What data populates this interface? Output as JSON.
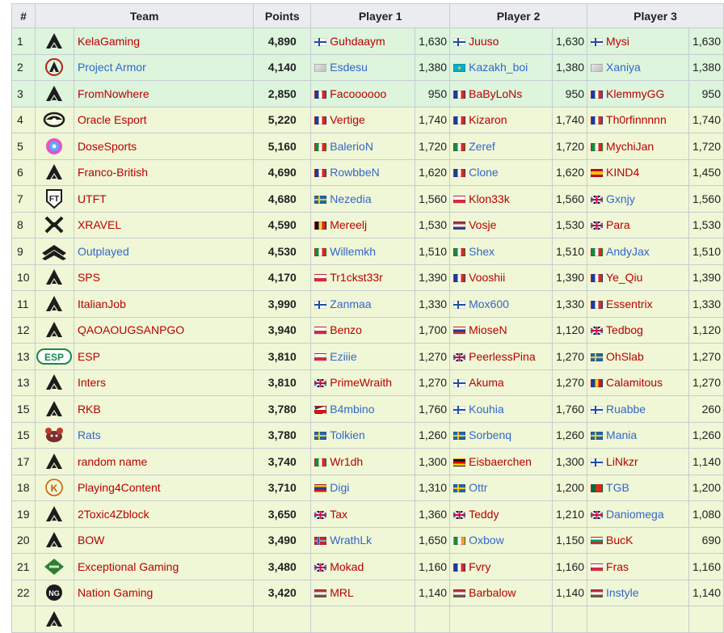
{
  "headers": {
    "rank": "#",
    "team": "Team",
    "points": "Points",
    "p1": "Player 1",
    "p2": "Player 2",
    "p3": "Player 3"
  },
  "rows": [
    {
      "rank": "1",
      "team": "KelaGaming",
      "team_link": "red",
      "logo": "apex-icon",
      "points": "4,890",
      "top": true,
      "p1": {
        "flag": "fi",
        "name": "Guhdaaym",
        "link": "red",
        "val": "1,630"
      },
      "p2": {
        "flag": "fi",
        "name": "Juuso",
        "link": "red",
        "val": "1,630"
      },
      "p3": {
        "flag": "fi",
        "name": "Mysi",
        "link": "red",
        "val": "1,630"
      }
    },
    {
      "rank": "2",
      "team": "Project Armor",
      "team_link": "blue",
      "logo": "project-armor-icon",
      "points": "4,140",
      "top": true,
      "p1": {
        "flag": "unk",
        "name": "Esdesu",
        "link": "blue",
        "val": "1,380"
      },
      "p2": {
        "flag": "kz",
        "name": "Kazakh_boi",
        "link": "blue",
        "val": "1,380"
      },
      "p3": {
        "flag": "unk",
        "name": "Xaniya",
        "link": "blue",
        "val": "1,380"
      }
    },
    {
      "rank": "3",
      "team": "FromNowhere",
      "team_link": "red",
      "logo": "apex-icon",
      "points": "2,850",
      "top": true,
      "p1": {
        "flag": "fr",
        "name": "Facoooooo",
        "link": "red",
        "val": "950"
      },
      "p2": {
        "flag": "fr",
        "name": "BaByLoNs",
        "link": "red",
        "val": "950"
      },
      "p3": {
        "flag": "fr",
        "name": "KlemmyGG",
        "link": "red",
        "val": "950"
      }
    },
    {
      "rank": "4",
      "team": "Oracle Esport",
      "team_link": "red",
      "logo": "oracle-icon",
      "points": "5,220",
      "top": false,
      "p1": {
        "flag": "fr",
        "name": "Vertige",
        "link": "red",
        "val": "1,740"
      },
      "p2": {
        "flag": "fr",
        "name": "Kizaron",
        "link": "red",
        "val": "1,740"
      },
      "p3": {
        "flag": "fr",
        "name": "Th0rfinnnnn",
        "link": "red",
        "val": "1,740"
      }
    },
    {
      "rank": "5",
      "team": "DoseSports",
      "team_link": "red",
      "logo": "dose-icon",
      "points": "5,160",
      "top": false,
      "p1": {
        "flag": "it",
        "name": "BalerioN",
        "link": "blue",
        "val": "1,720"
      },
      "p2": {
        "flag": "it",
        "name": "Zeref",
        "link": "blue",
        "val": "1,720"
      },
      "p3": {
        "flag": "it",
        "name": "MychiJan",
        "link": "red",
        "val": "1,720"
      }
    },
    {
      "rank": "6",
      "team": "Franco-British",
      "team_link": "red",
      "logo": "apex-icon",
      "points": "4,690",
      "top": false,
      "p1": {
        "flag": "fr",
        "name": "RowbbeN",
        "link": "blue",
        "val": "1,620"
      },
      "p2": {
        "flag": "fr",
        "name": "Clone",
        "link": "blue",
        "val": "1,620"
      },
      "p3": {
        "flag": "es",
        "name": "KIND4",
        "link": "red",
        "val": "1,450"
      }
    },
    {
      "rank": "7",
      "team": "UTFT",
      "team_link": "red",
      "logo": "utft-icon",
      "points": "4,680",
      "top": false,
      "p1": {
        "flag": "se",
        "name": "Nezedia",
        "link": "blue",
        "val": "1,560"
      },
      "p2": {
        "flag": "pl",
        "name": "Klon33k",
        "link": "red",
        "val": "1,560"
      },
      "p3": {
        "flag": "gb",
        "name": "Gxnjy",
        "link": "blue",
        "val": "1,560"
      }
    },
    {
      "rank": "8",
      "team": "XRAVEL",
      "team_link": "red",
      "logo": "xravel-icon",
      "points": "4,590",
      "top": false,
      "p1": {
        "flag": "be",
        "name": "Mereelj",
        "link": "red",
        "val": "1,530"
      },
      "p2": {
        "flag": "nl",
        "name": "Vosje",
        "link": "red",
        "val": "1,530"
      },
      "p3": {
        "flag": "gb",
        "name": "Para",
        "link": "red",
        "val": "1,530"
      }
    },
    {
      "rank": "9",
      "team": "Outplayed",
      "team_link": "blue",
      "logo": "outplayed-icon",
      "points": "4,530",
      "top": false,
      "p1": {
        "flag": "it",
        "name": "Willemkh",
        "link": "blue",
        "val": "1,510"
      },
      "p2": {
        "flag": "it",
        "name": "Shex",
        "link": "blue",
        "val": "1,510"
      },
      "p3": {
        "flag": "it",
        "name": "AndyJax",
        "link": "blue",
        "val": "1,510"
      }
    },
    {
      "rank": "10",
      "team": "SPS",
      "team_link": "red",
      "logo": "apex-icon",
      "points": "4,170",
      "top": false,
      "p1": {
        "flag": "pl",
        "name": "Tr1ckst33r",
        "link": "red",
        "val": "1,390"
      },
      "p2": {
        "flag": "fr",
        "name": "Vooshii",
        "link": "red",
        "val": "1,390"
      },
      "p3": {
        "flag": "fr",
        "name": "Ye_Qiu",
        "link": "red",
        "val": "1,390"
      }
    },
    {
      "rank": "11",
      "team": "ItalianJob",
      "team_link": "red",
      "logo": "apex-icon",
      "points": "3,990",
      "top": false,
      "p1": {
        "flag": "fi",
        "name": "Zanmaa",
        "link": "blue",
        "val": "1,330"
      },
      "p2": {
        "flag": "fi",
        "name": "Mox600",
        "link": "blue",
        "val": "1,330"
      },
      "p3": {
        "flag": "fr",
        "name": "Essentrix",
        "link": "red",
        "val": "1,330"
      }
    },
    {
      "rank": "12",
      "team": "QAOAOUGSANPGO",
      "team_link": "red",
      "logo": "apex-icon",
      "points": "3,940",
      "top": false,
      "p1": {
        "flag": "pl",
        "name": "Benzo",
        "link": "red",
        "val": "1,700"
      },
      "p2": {
        "flag": "sk",
        "name": "MioseN",
        "link": "red",
        "val": "1,120"
      },
      "p3": {
        "flag": "gb",
        "name": "Tedbog",
        "link": "red",
        "val": "1,120"
      }
    },
    {
      "rank": "13",
      "team": "ESP",
      "team_link": "red",
      "logo": "esp-icon",
      "points": "3,810",
      "top": false,
      "p1": {
        "flag": "pl",
        "name": "Eziiie",
        "link": "blue",
        "val": "1,270"
      },
      "p2": {
        "flag": "gb",
        "name": "PeerlessPina",
        "link": "red",
        "val": "1,270"
      },
      "p3": {
        "flag": "se",
        "name": "OhSlab",
        "link": "red",
        "val": "1,270"
      }
    },
    {
      "rank": "13",
      "team": "Inters",
      "team_link": "red",
      "logo": "apex-icon",
      "points": "3,810",
      "top": false,
      "p1": {
        "flag": "gb",
        "name": "PrimeWraith",
        "link": "red",
        "val": "1,270"
      },
      "p2": {
        "flag": "fi",
        "name": "Akuma",
        "link": "red",
        "val": "1,270"
      },
      "p3": {
        "flag": "ro",
        "name": "Calamitous",
        "link": "red",
        "val": "1,270"
      }
    },
    {
      "rank": "15",
      "team": "RKB",
      "team_link": "red",
      "logo": "apex-icon",
      "points": "3,780",
      "top": false,
      "p1": {
        "flag": "cz",
        "name": "B4mbino",
        "link": "blue",
        "val": "1,760"
      },
      "p2": {
        "flag": "fi",
        "name": "Kouhia",
        "link": "blue",
        "val": "1,760"
      },
      "p3": {
        "flag": "fi",
        "name": "Ruabbe",
        "link": "blue",
        "val": "260"
      }
    },
    {
      "rank": "15",
      "team": "Rats",
      "team_link": "blue",
      "logo": "rats-icon",
      "points": "3,780",
      "top": false,
      "p1": {
        "flag": "se",
        "name": "Tolkien",
        "link": "blue",
        "val": "1,260"
      },
      "p2": {
        "flag": "se",
        "name": "Sorbenq",
        "link": "blue",
        "val": "1,260"
      },
      "p3": {
        "flag": "se",
        "name": "Mania",
        "link": "blue",
        "val": "1,260"
      }
    },
    {
      "rank": "17",
      "team": "random name",
      "team_link": "red",
      "logo": "apex-icon",
      "points": "3,740",
      "top": false,
      "p1": {
        "flag": "it",
        "name": "Wr1dh",
        "link": "red",
        "val": "1,300"
      },
      "p2": {
        "flag": "de",
        "name": "Eisbaerchen",
        "link": "red",
        "val": "1,300"
      },
      "p3": {
        "flag": "fi",
        "name": "LiNkzr",
        "link": "red",
        "val": "1,140"
      }
    },
    {
      "rank": "18",
      "team": "Playing4Content",
      "team_link": "red",
      "logo": "p4c-icon",
      "points": "3,710",
      "top": false,
      "p1": {
        "flag": "ve",
        "name": "Digi",
        "link": "blue",
        "val": "1,310"
      },
      "p2": {
        "flag": "se",
        "name": "Ottr",
        "link": "blue",
        "val": "1,200"
      },
      "p3": {
        "flag": "pt",
        "name": "TGB",
        "link": "blue",
        "val": "1,200"
      }
    },
    {
      "rank": "19",
      "team": "2Toxic4Zblock",
      "team_link": "red",
      "logo": "apex-icon",
      "points": "3,650",
      "top": false,
      "p1": {
        "flag": "gb",
        "name": "Tax",
        "link": "red",
        "val": "1,360"
      },
      "p2": {
        "flag": "gb",
        "name": "Teddy",
        "link": "red",
        "val": "1,210"
      },
      "p3": {
        "flag": "gb",
        "name": "Daniomega",
        "link": "blue",
        "val": "1,080"
      }
    },
    {
      "rank": "20",
      "team": "BOW",
      "team_link": "red",
      "logo": "apex-icon",
      "points": "3,490",
      "top": false,
      "p1": {
        "flag": "no",
        "name": "WrathLk",
        "link": "blue",
        "val": "1,650"
      },
      "p2": {
        "flag": "ie",
        "name": "Oxbow",
        "link": "blue",
        "val": "1,150"
      },
      "p3": {
        "flag": "bg",
        "name": "BucK",
        "link": "red",
        "val": "690"
      }
    },
    {
      "rank": "21",
      "team": "Exceptional Gaming",
      "team_link": "red",
      "logo": "exceptional-icon",
      "points": "3,480",
      "top": false,
      "p1": {
        "flag": "gb",
        "name": "Mokad",
        "link": "red",
        "val": "1,160"
      },
      "p2": {
        "flag": "fr",
        "name": "Fvry",
        "link": "red",
        "val": "1,160"
      },
      "p3": {
        "flag": "pl",
        "name": "Fras",
        "link": "red",
        "val": "1,160"
      }
    },
    {
      "rank": "22",
      "team": "Nation Gaming",
      "team_link": "red",
      "logo": "nation-icon",
      "points": "3,420",
      "top": false,
      "p1": {
        "flag": "hu",
        "name": "MRL",
        "link": "red",
        "val": "1,140"
      },
      "p2": {
        "flag": "hu",
        "name": "Barbalow",
        "link": "red",
        "val": "1,140"
      },
      "p3": {
        "flag": "hu",
        "name": "Instyle",
        "link": "blue",
        "val": "1,140"
      }
    },
    {
      "rank": "",
      "team": "",
      "team_link": "red",
      "logo": "apex-icon",
      "points": "",
      "top": false,
      "p1": {
        "flag": "",
        "name": "",
        "link": "red",
        "val": ""
      },
      "p2": {
        "flag": "",
        "name": "",
        "link": "red",
        "val": ""
      },
      "p3": {
        "flag": "",
        "name": "",
        "link": "red",
        "val": ""
      }
    }
  ]
}
